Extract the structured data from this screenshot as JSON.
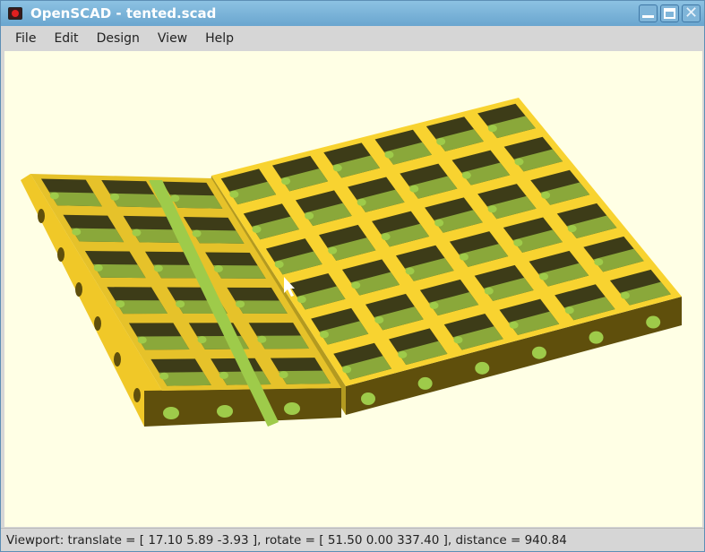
{
  "window": {
    "title": "OpenSCAD - tented.scad",
    "minimize_label": "minimize",
    "maximize_label": "maximize",
    "close_glyph": "✕"
  },
  "menu": [
    {
      "label": "File"
    },
    {
      "label": "Edit"
    },
    {
      "label": "Design"
    },
    {
      "label": "View"
    },
    {
      "label": "Help"
    }
  ],
  "viewport": {
    "model_colors": {
      "top": "#f8d330",
      "side": "#5f4f0c",
      "hole": "#3d3c18",
      "hole_light": "#9ecb4a"
    }
  },
  "status": {
    "text": "Viewport: translate = [ 17.10 5.89 -3.93 ], rotate = [ 51.50 0.00 337.40 ], distance = 940.84"
  }
}
